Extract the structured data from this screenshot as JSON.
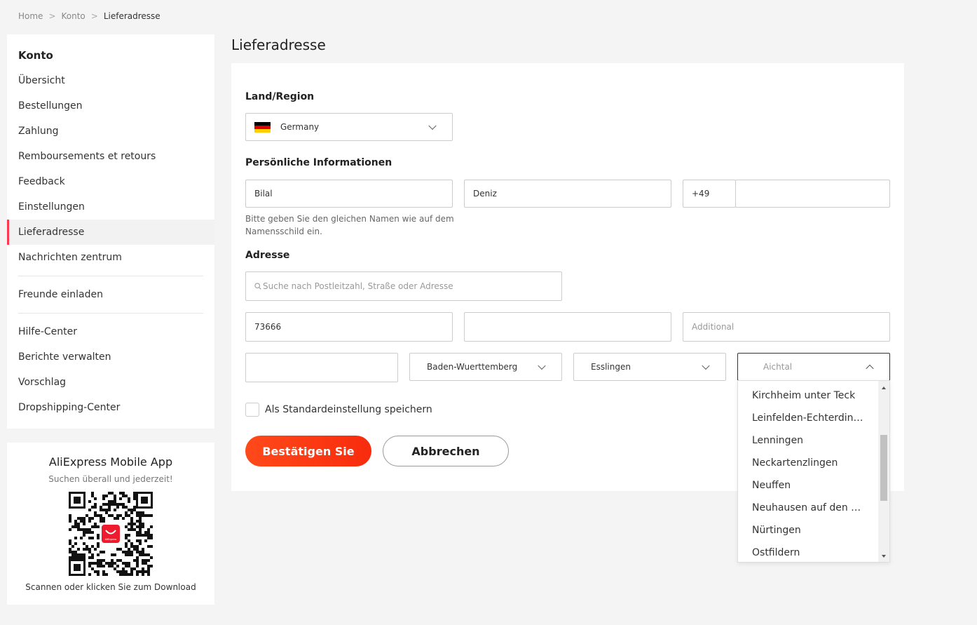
{
  "breadcrumb": {
    "items": [
      "Home",
      "Konto",
      "Lieferadresse"
    ],
    "separator": ">"
  },
  "sidebar": {
    "heading": "Konto",
    "items": [
      "Übersicht",
      "Bestellungen",
      "Zahlung",
      "Remboursements et retours",
      "Feedback",
      "Einstellungen",
      "Lieferadresse",
      "Nachrichten zentrum",
      "Freunde einladen",
      "Hilfe-Center",
      "Berichte verwalten",
      "Vorschlag",
      "Dropshipping-Center"
    ],
    "active_item": "Lieferadresse",
    "accent_color": "#fd384f"
  },
  "app_promo": {
    "title": "AliExpress Mobile App",
    "subtitle": "Suchen überall und jederzeit!",
    "qr_logo_text": "AliExpress",
    "scan_text": "Scannen oder klicken Sie zum Download"
  },
  "page_title": "Lieferadresse",
  "form": {
    "country_section": "Land/Region",
    "country_value": "Germany",
    "country_flag": "flag-germany-icon",
    "personal_section": "Persönliche Informationen",
    "first_name": "Bilal",
    "last_name": "Deniz",
    "phone_code": "+49",
    "phone_number": "",
    "name_hint": "Bitte geben Sie den gleichen Namen wie auf dem Namensschild ein.",
    "address_section": "Adresse",
    "search_placeholder": "Suche nach Postleitzahl, Straße oder Adresse",
    "search_icon": "search-icon",
    "postcode": "73666",
    "street": "",
    "additional_placeholder": "Additional",
    "house_number": "",
    "state": "Baden-Wuerttemberg",
    "district": "Esslingen",
    "city": "Aichtal",
    "default_checkbox_label": "Als Standardeinstellung speichern",
    "confirm_label": "Bestätigen Sie",
    "cancel_label": "Abbrechen",
    "primary_color": "#f82b0d"
  },
  "city_dropdown": {
    "options": [
      "Kirchheim unter Teck",
      "Leinfelden-Echterdingen",
      "Lenningen",
      "Neckartenzlingen",
      "Neuffen",
      "Neuhausen auf den Fildern",
      "Nürtingen",
      "Ostfildern"
    ]
  }
}
